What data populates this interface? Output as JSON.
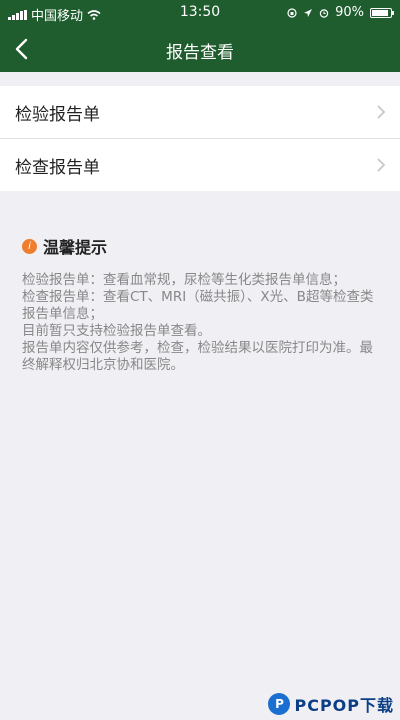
{
  "status_bar": {
    "carrier": "中国移动",
    "time": "13:50",
    "battery": "90%",
    "battery_level": 0.9
  },
  "nav": {
    "title": "报告查看",
    "back_icon": "chevron-left-icon"
  },
  "menu": {
    "items": [
      {
        "label": "检验报告单",
        "icon": "chevron-right-icon"
      },
      {
        "label": "检查报告单",
        "icon": "chevron-right-icon"
      }
    ]
  },
  "tips": {
    "title": "温馨提示",
    "icon": "info-icon",
    "icon_text": "i",
    "lines": [
      "检验报告单：查看血常规，尿检等生化类报告单信息；",
      "检查报告单：查看CT、MRI（磁共振）、X光、B超等检查类报告单信息；",
      "目前暂只支持检验报告单查看。",
      "报告单内容仅供参考，检查，检验结果以医院打印为准。最终解释权归北京协和医院。"
    ]
  },
  "watermark": {
    "logo_text": "P",
    "text": "PCPOP下载"
  },
  "colors": {
    "header_bg": "#1f5c2e",
    "page_bg": "#efeff4",
    "tip_icon": "#ee7d2d"
  }
}
